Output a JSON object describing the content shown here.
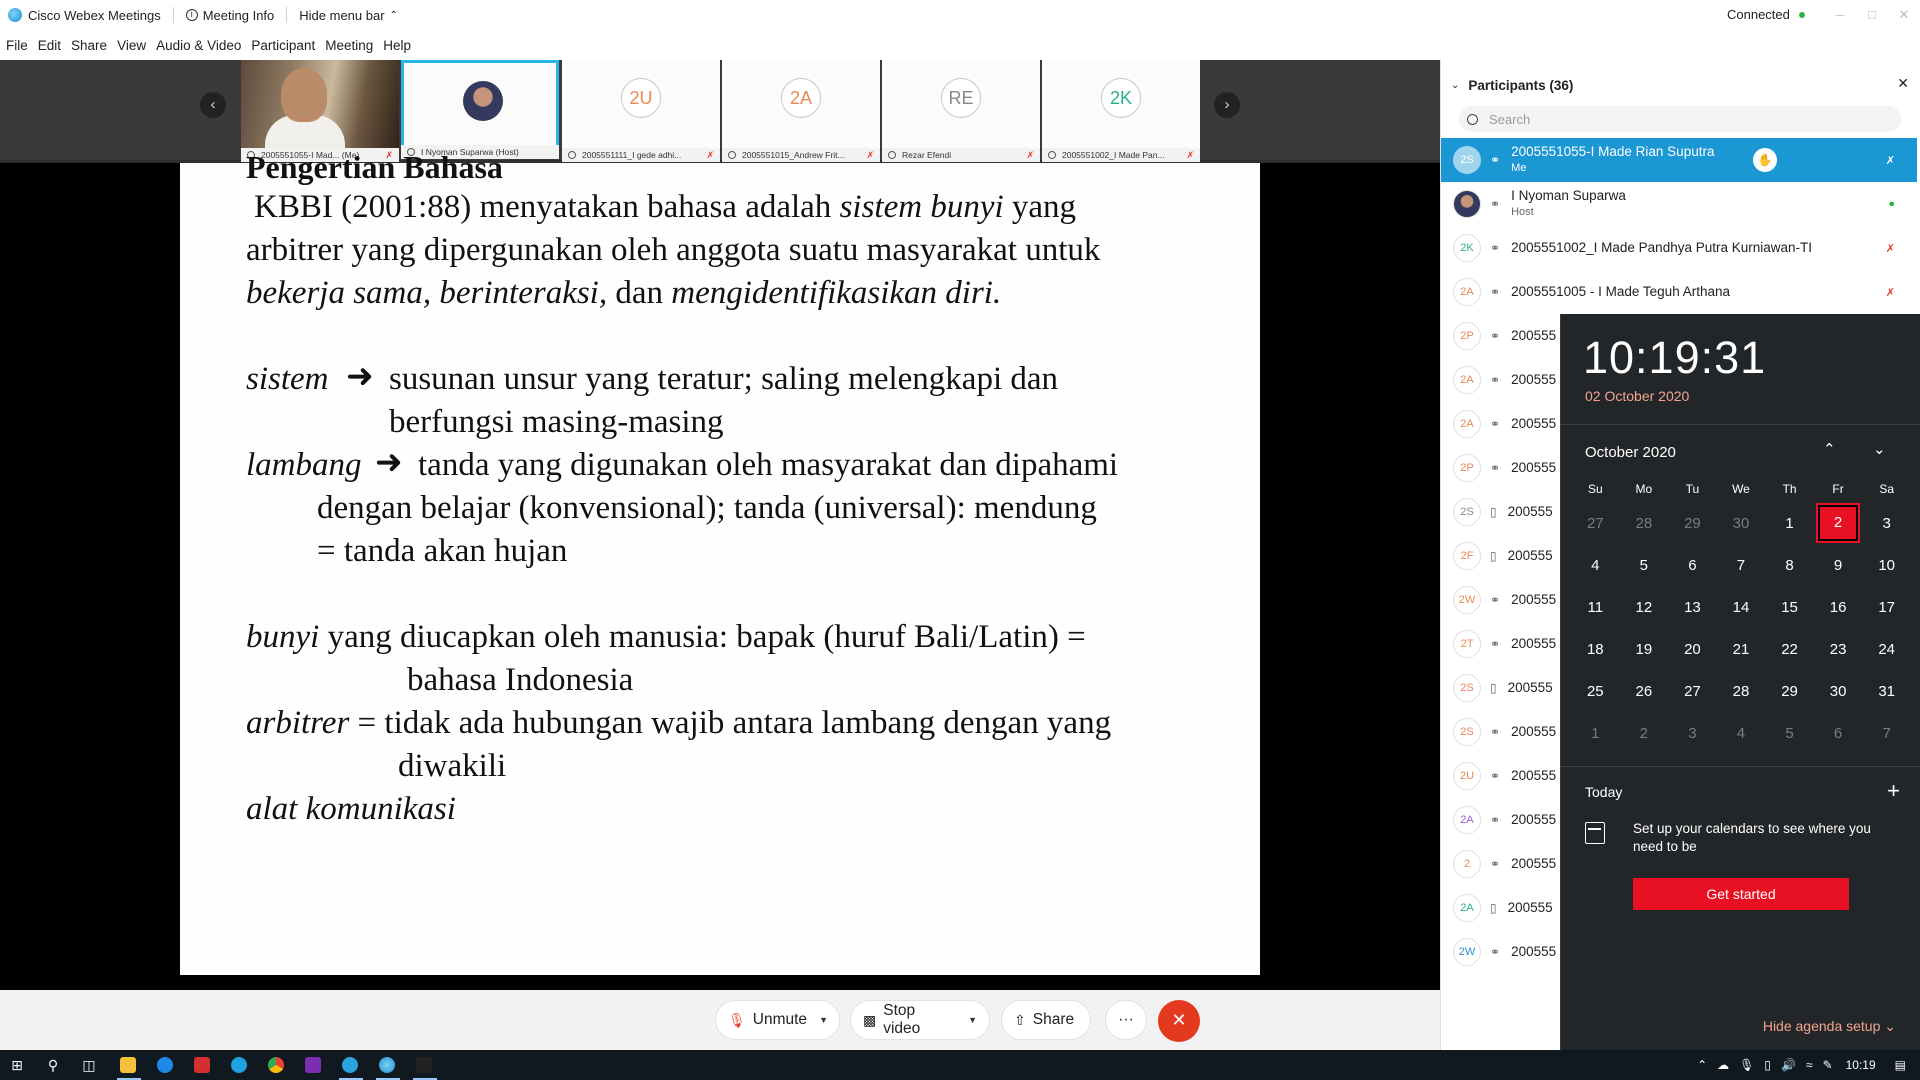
{
  "titlebar": {
    "app_name": "Cisco Webex Meetings",
    "meeting_info": "Meeting Info",
    "hide_menu": "Hide menu bar",
    "status": "Connected"
  },
  "menu": [
    "File",
    "Edit",
    "Share",
    "View",
    "Audio & Video",
    "Participant",
    "Meeting",
    "Help"
  ],
  "thumbnails": [
    {
      "initials": "",
      "label": "2005551055-I Mad... (Me)"
    },
    {
      "initials": "",
      "label": "I Nyoman Suparwa (Host)"
    },
    {
      "initials": "2U",
      "label": "2005551111_I gede adhi..."
    },
    {
      "initials": "2A",
      "label": "2005551015_Andrew Frit..."
    },
    {
      "initials": "RE",
      "label": "Rezar Efendi"
    },
    {
      "initials": "2K",
      "label": "2005551002_I Made Pan..."
    }
  ],
  "slide": {
    "title": "Pengertian Bahasa",
    "l1a": "KBBI (2001:88) menyatakan bahasa adalah ",
    "l1b": "sistem bunyi",
    "l1c": " yang",
    "l2": "arbitrer yang dipergunakan oleh anggota suatu masyarakat untuk",
    "l3a": "bekerja sama, berinteraksi,",
    "l3b": " dan ",
    "l3c": "mengidentifikasikan diri.",
    "sistem": "sistem",
    "sistem_def1": "susunan unsur yang teratur; saling melengkapi dan",
    "sistem_def2": "berfungsi masing-masing",
    "lambang": "lambang",
    "lambang_def1": "tanda yang digunakan oleh masyarakat dan dipahami",
    "lambang_def2": "dengan belajar (konvensional); tanda (universal): mendung",
    "lambang_def3": "= tanda akan hujan",
    "bunyi": "bunyi",
    "bunyi_def1": " yang diucapkan oleh manusia: bapak (huruf Bali/Latin) =",
    "bunyi_def2": "bahasa Indonesia",
    "arbitrer": "arbitrer",
    "arbitrer_def1": " = tidak ada hubungan wajib antara lambang dengan yang",
    "arbitrer_def2": "diwakili",
    "alat": "alat komunikasi"
  },
  "controls": {
    "unmute": "Unmute",
    "stop_video": "Stop video",
    "share": "Share",
    "more": "···"
  },
  "participants": {
    "header": "Participants (36)",
    "search_placeholder": "Search",
    "rows": [
      {
        "initials": "2S",
        "name": "2005551055-I Made Rian Suputra",
        "sub": "Me"
      },
      {
        "initials": "",
        "name": "I Nyoman Suparwa",
        "sub": "Host"
      },
      {
        "initials": "2K",
        "name": "2005551002_I Made Pandhya Putra Kurniawan-TI",
        "sub": ""
      },
      {
        "initials": "2A",
        "name": "2005551005 - I Made Teguh Arthana",
        "sub": ""
      },
      {
        "initials": "2P",
        "name": "200555",
        "sub": ""
      },
      {
        "initials": "2A",
        "name": "200555",
        "sub": ""
      },
      {
        "initials": "2A",
        "name": "200555",
        "sub": ""
      },
      {
        "initials": "2P",
        "name": "200555",
        "sub": ""
      },
      {
        "initials": "2S",
        "name": "200555",
        "sub": ""
      },
      {
        "initials": "2F",
        "name": "200555",
        "sub": ""
      },
      {
        "initials": "2W",
        "name": "200555",
        "sub": ""
      },
      {
        "initials": "2T",
        "name": "200555",
        "sub": ""
      },
      {
        "initials": "2S",
        "name": "200555",
        "sub": ""
      },
      {
        "initials": "2S",
        "name": "200555",
        "sub": ""
      },
      {
        "initials": "2U",
        "name": "200555",
        "sub": ""
      },
      {
        "initials": "2A",
        "name": "200555",
        "sub": ""
      },
      {
        "initials": "2",
        "name": "200555",
        "sub": ""
      },
      {
        "initials": "2A",
        "name": "200555",
        "sub": ""
      },
      {
        "initials": "2W",
        "name": "200555",
        "sub": ""
      }
    ]
  },
  "clock": {
    "time": "10:19:31",
    "date": "02 October 2020",
    "month": "October 2020",
    "weekdays": [
      "Su",
      "Mo",
      "Tu",
      "We",
      "Th",
      "Fr",
      "Sa"
    ],
    "weeks": [
      [
        "27",
        "28",
        "29",
        "30",
        "1",
        "2",
        "3"
      ],
      [
        "4",
        "5",
        "6",
        "7",
        "8",
        "9",
        "10"
      ],
      [
        "11",
        "12",
        "13",
        "14",
        "15",
        "16",
        "17"
      ],
      [
        "18",
        "19",
        "20",
        "21",
        "22",
        "23",
        "24"
      ],
      [
        "25",
        "26",
        "27",
        "28",
        "29",
        "30",
        "31"
      ],
      [
        "1",
        "2",
        "3",
        "4",
        "5",
        "6",
        "7"
      ]
    ],
    "today_label": "Today",
    "setup_text": "Set up your calendars to see where you need to be",
    "get_started": "Get started",
    "hide_agenda": "Hide agenda setup"
  },
  "taskbar": {
    "time": "10:19"
  },
  "colors": {
    "accent": "#1b97d3",
    "end_call": "#e3391e",
    "today_red": "#e81123",
    "taskbar": "#101820"
  }
}
